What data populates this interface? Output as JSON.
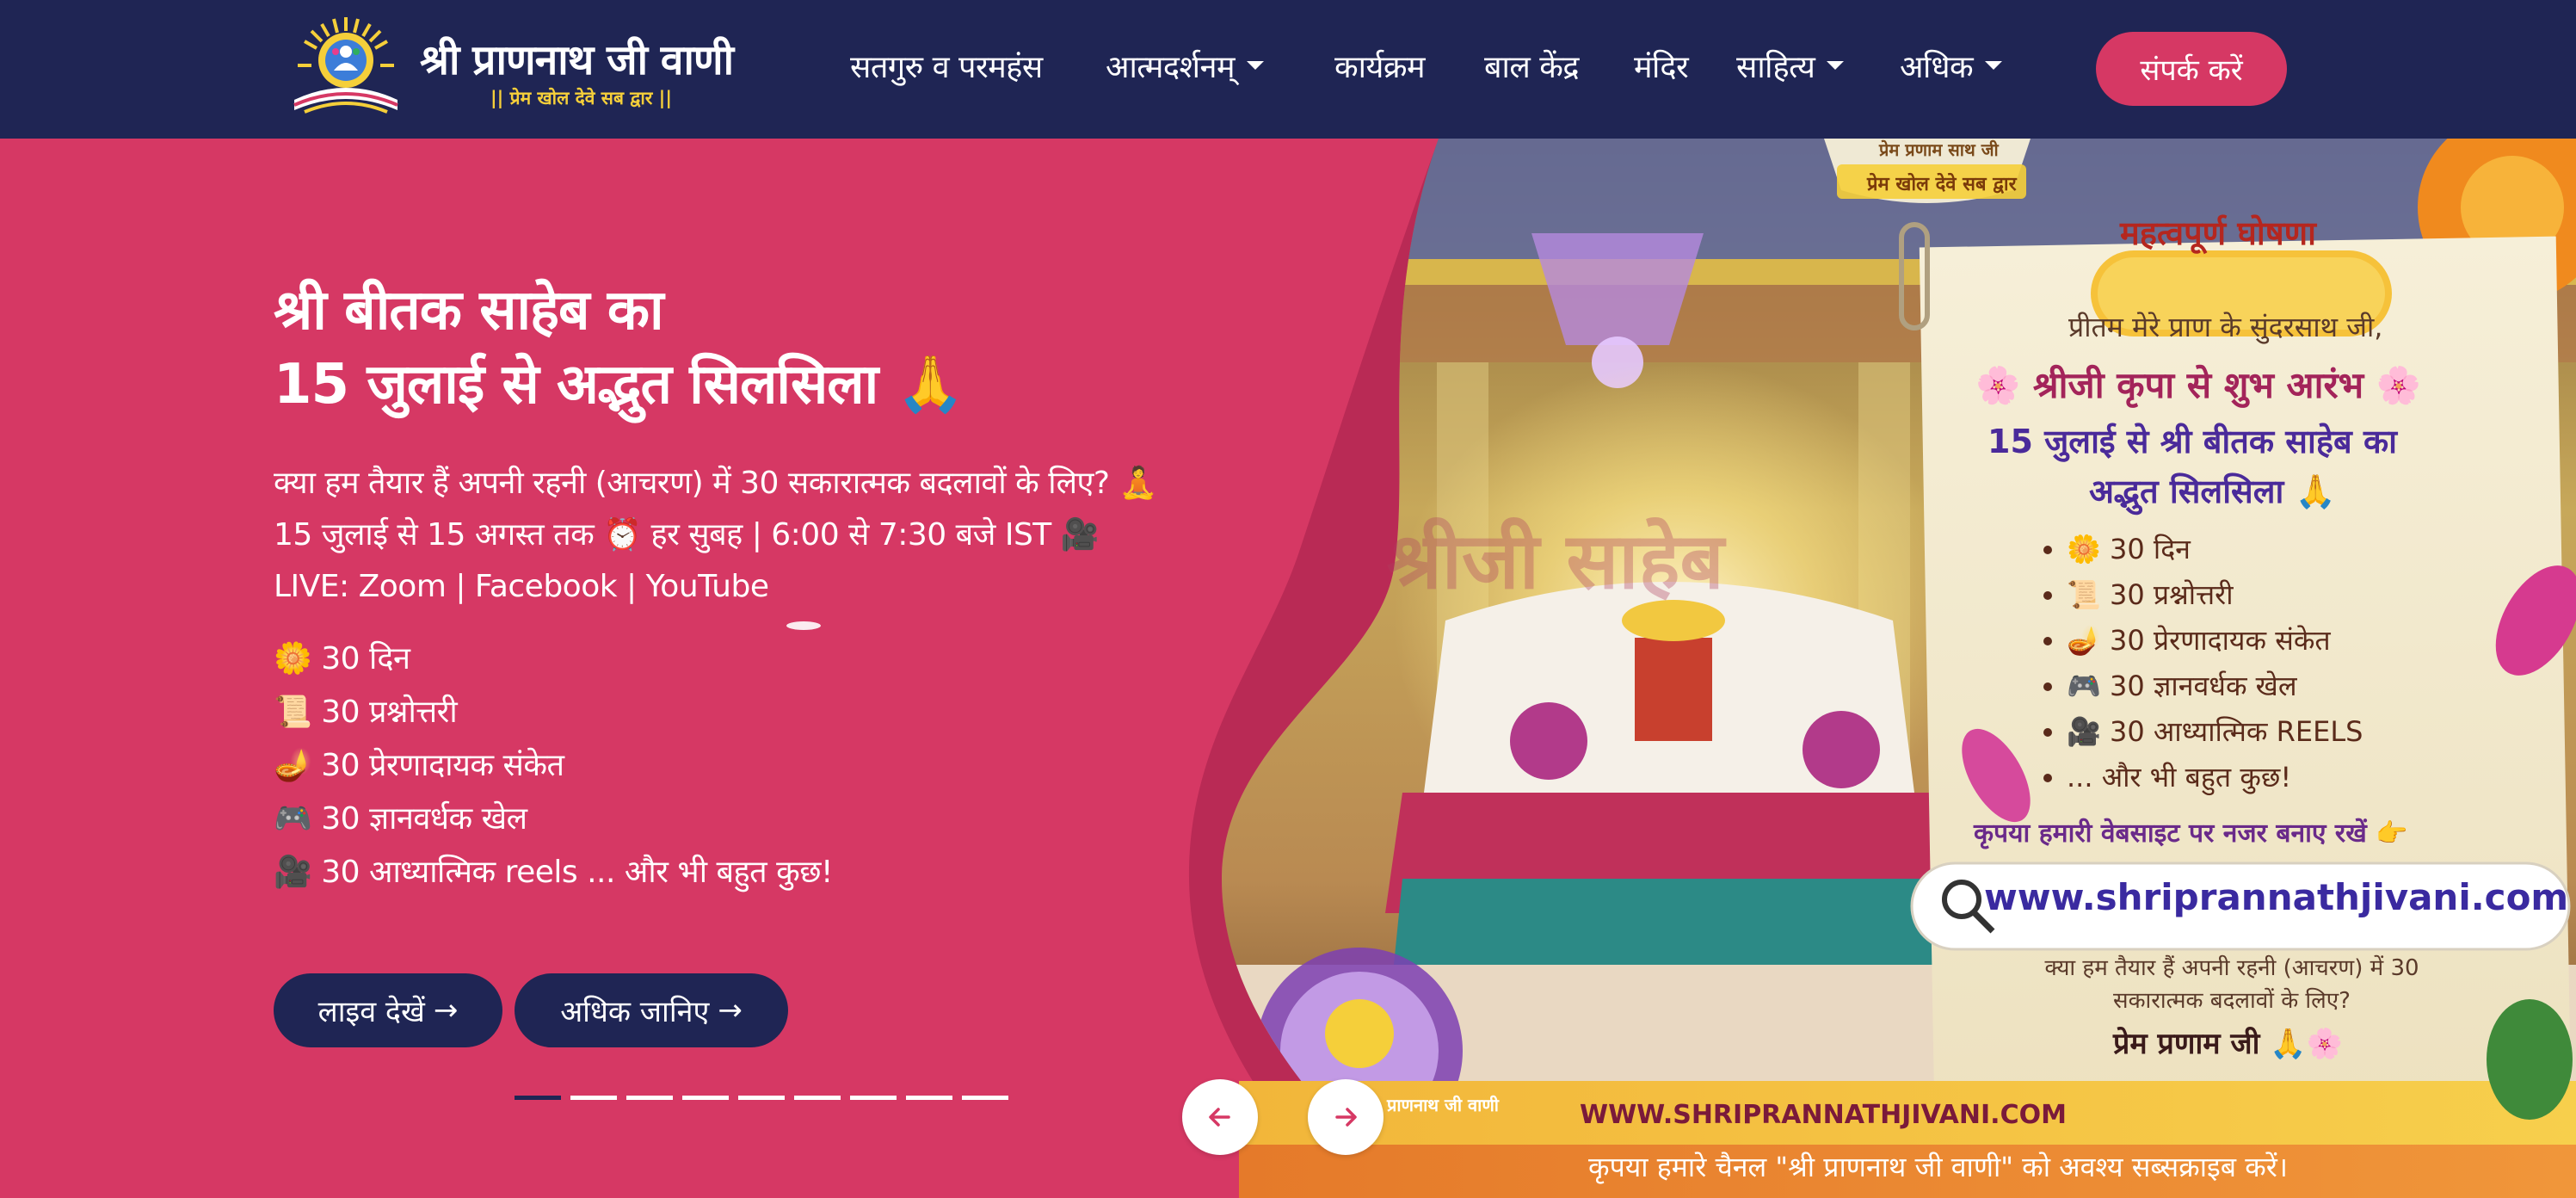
{
  "nav": {
    "brand_title": "श्री प्राणनाथ जी वाणी",
    "brand_tagline": "|| प्रेम खोल देवे सब द्वार ||",
    "items": [
      {
        "label": "सतगुरु व परमहंस",
        "has_dropdown": false
      },
      {
        "label": "आत्मदर्शनम्",
        "has_dropdown": true
      },
      {
        "label": "कार्यक्रम",
        "has_dropdown": false
      },
      {
        "label": "बाल केंद्र",
        "has_dropdown": false
      },
      {
        "label": "मंदिर",
        "has_dropdown": false
      },
      {
        "label": "साहित्य",
        "has_dropdown": true
      },
      {
        "label": "अधिक",
        "has_dropdown": true
      }
    ],
    "contact_label": "संपर्क करें"
  },
  "hero": {
    "title_line1": "श्री बीतक साहेब का",
    "title_line2": "15 जुलाई से अद्भुत सिलसिला 🙏",
    "description": "क्या हम तैयार हैं अपनी रहनी (आचरण) में 30 सकारात्मक बदलावों के लिए? 🧘 15 जुलाई से 15 अगस्त तक ⏰ हर सुबह | 6:00 से 7:30 बजे IST 🎥 LIVE: Zoom | Facebook | YouTube",
    "features": [
      "🌼 30 दिन",
      "📜 30 प्रश्नोत्तरी",
      "🪔 30 प्रेरणादायक संकेत",
      "🎮 30 ज्ञानवर्धक खेल",
      "🎥 30 आध्यात्मिक reels ... और भी बहुत कुछ!"
    ],
    "live_button": "लाइव देखें",
    "more_button": "अधिक जानिए",
    "slide_count": 9,
    "active_slide": 1
  },
  "poster": {
    "top_badge_line1": "प्रेम प्रणाम साथ जी",
    "top_badge_line2": "प्रेम खोल देवे सब द्वार",
    "announcement": "महत्वपूर्ण घोषणा",
    "greeting": "प्रीतम मेरे प्राण के सुंदरसाथ जी,",
    "blessing": "🌸 श्रीजी कृपा से शुभ आरंभ 🌸",
    "headline_line1": "15 जुलाई से श्री बीतक साहेब का",
    "headline_line2": "अद्भुत सिलसिला 🙏",
    "bullets": [
      "🌼 30 दिन",
      "📜 30 प्रश्नोत्तरी",
      "🪔 30 प्रेरणादायक संकेत",
      "🎮 30 ज्ञानवर्धक खेल",
      "🎥 30 आध्यात्मिक REELS",
      "... और भी बहुत कुछ!"
    ],
    "watch_site": "कृपया हमारी वेबसाइट पर नजर बनाए रखें 👉",
    "website": "www.shriprannathjivani.com",
    "question": "क्या हम तैयार हैं अपनी रहनी (आचरण) में 30 सकारात्मक बदलावों के लिए?",
    "signoff": "प्रेम प्रणाम जी 🙏🌸",
    "watermark": "श्रीजी साहेब",
    "footer_url": "WWW.SHRIPRANNATHJIVANI.COM",
    "footer_cta": "कृपया हमारे चैनल \"श्री प्राणनाथ जी वाणी\" को अवश्य सब्सक्राइब करें।",
    "seal_text": "प्राणनाथ जी वाणी"
  },
  "colors": {
    "navy": "#1f2554",
    "pink": "#d63864",
    "gold": "#f5cf3a",
    "white": "#ffffff"
  },
  "icons": {
    "prev": "arrow-left-icon",
    "next": "arrow-right-icon",
    "dropdown": "caret-down-icon",
    "search": "search-icon"
  }
}
